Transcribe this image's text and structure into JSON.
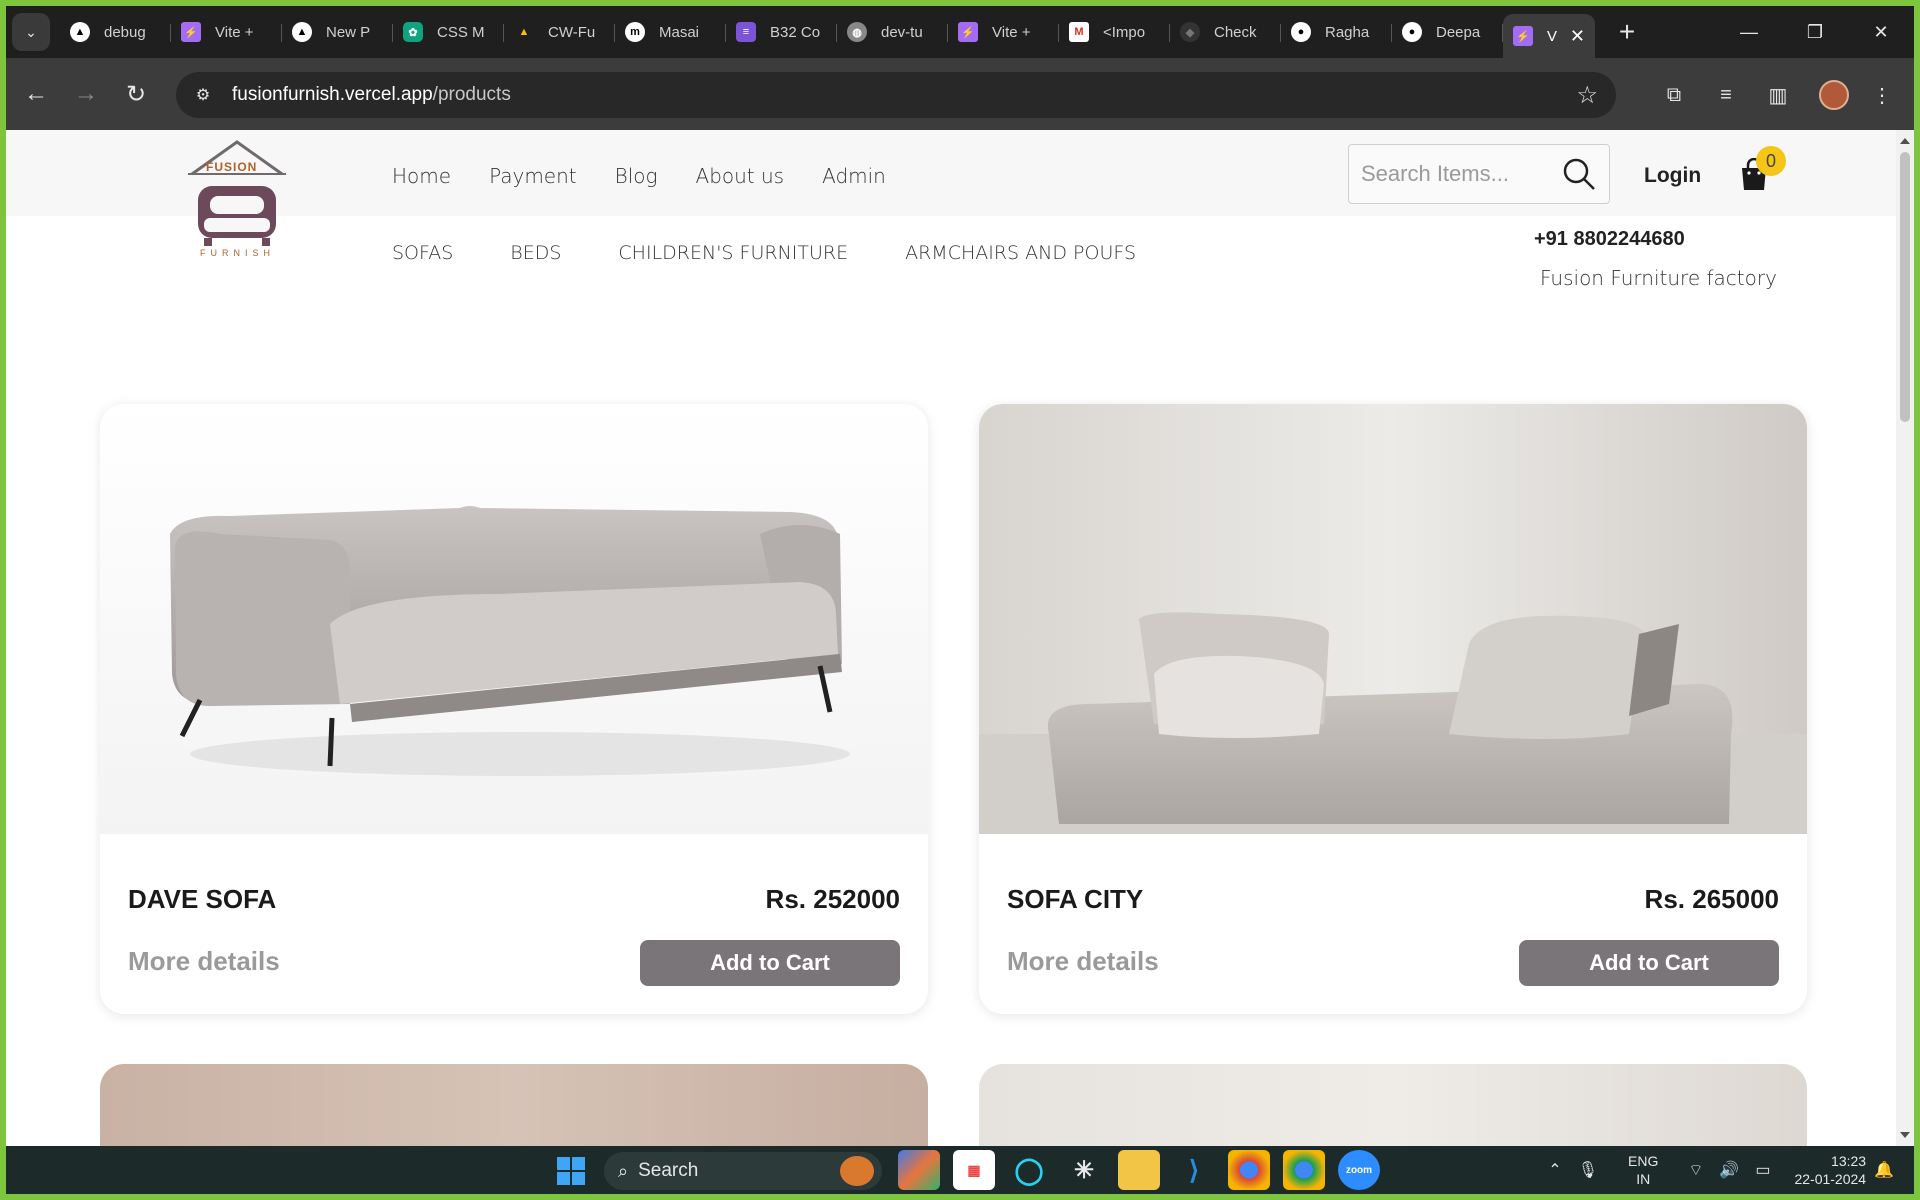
{
  "browser": {
    "tabs": [
      {
        "label": "debug",
        "icon": "nextjs-icon"
      },
      {
        "label": "Vite +",
        "icon": "vite-icon"
      },
      {
        "label": "New P",
        "icon": "nextjs-icon"
      },
      {
        "label": "CSS M",
        "icon": "chatgpt-icon"
      },
      {
        "label": "CW-Fu",
        "icon": "google-drive-icon"
      },
      {
        "label": "Masai",
        "icon": "masai-icon"
      },
      {
        "label": "B32 Co",
        "icon": "list-icon"
      },
      {
        "label": "dev-tu",
        "icon": "globe-icon"
      },
      {
        "label": "Vite +",
        "icon": "vite-icon"
      },
      {
        "label": "<Impo",
        "icon": "gmail-icon"
      },
      {
        "label": "Check",
        "icon": "dark-icon"
      },
      {
        "label": "Ragha",
        "icon": "github-icon"
      },
      {
        "label": "Deepa",
        "icon": "github-icon"
      }
    ],
    "active_tab": {
      "label": "V",
      "icon": "vite-icon"
    },
    "url_host": "fusionfurnish.vercel.app",
    "url_path": "/products"
  },
  "site": {
    "logo_text_top": "FUSION",
    "logo_text_bottom": "FURNISH",
    "nav": [
      "Home",
      "Payment",
      "Blog",
      "About us",
      "Admin"
    ],
    "search_placeholder": "Search Items...",
    "login_label": "Login",
    "cart_count": "0",
    "categories": [
      "SOFAS",
      "BEDS",
      "CHILDREN'S FURNITURE",
      "ARMCHAIRS AND POUFS"
    ],
    "phone": "+91 8802244680",
    "factory": "Fusion Furniture factory"
  },
  "products": [
    {
      "name": "DAVE SOFA",
      "price": "Rs. 252000",
      "more_label": "More details",
      "cart_label": "Add to Cart"
    },
    {
      "name": "SOFA CITY",
      "price": "Rs. 265000",
      "more_label": "More details",
      "cart_label": "Add to Cart"
    }
  ],
  "taskbar": {
    "search_label": "Search",
    "lang_top": "ENG",
    "lang_bottom": "IN",
    "time": "13:23",
    "date": "22-01-2024"
  },
  "colors": {
    "button": "#7a7578",
    "badge": "#f5c518",
    "frame": "#7cc53d"
  }
}
